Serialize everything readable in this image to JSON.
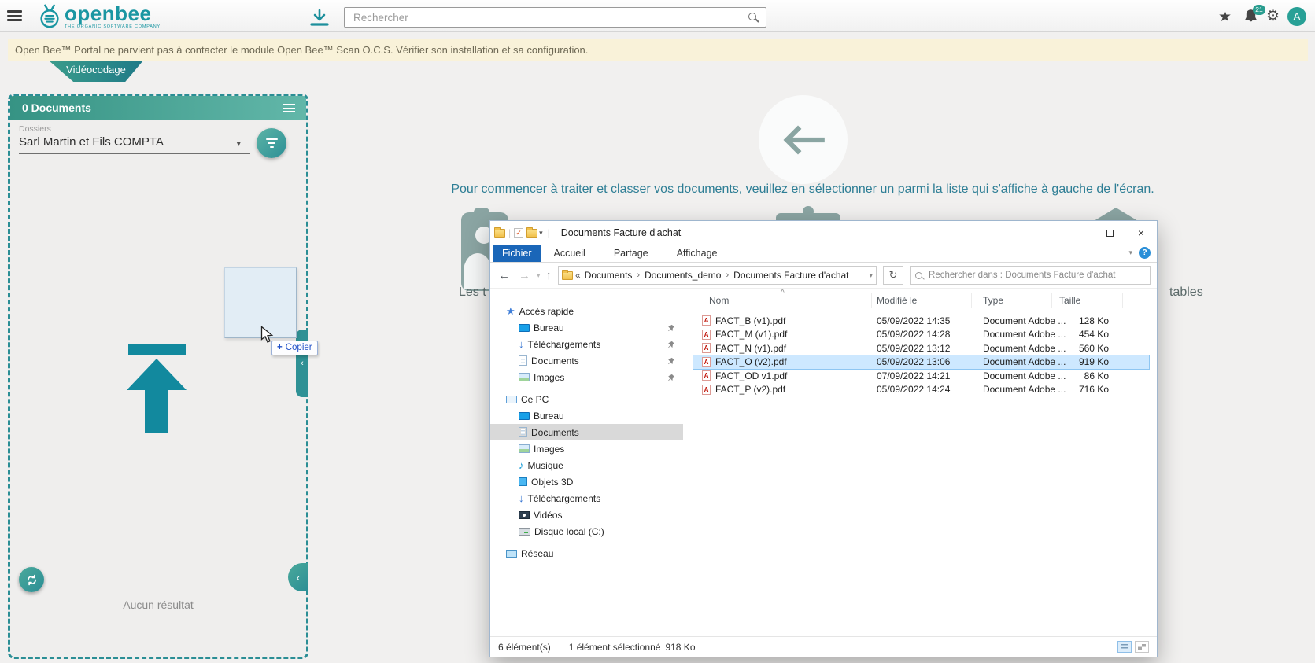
{
  "topbar": {
    "logo_text": "openbee",
    "logo_tagline": "THE ORGANIC SOFTWARE COMPANY",
    "search_placeholder": "Rechercher",
    "notifications_badge": "21",
    "avatar_letter": "A"
  },
  "banner": {
    "message": "Open Bee™ Portal ne parvient pas à contacter le module Open Bee™ Scan O.C.S. Vérifier son installation et sa configuration."
  },
  "workflow_tab": {
    "label": "Vidéocodage"
  },
  "documents_panel": {
    "header_title": "0 Documents",
    "folders_label": "Dossiers",
    "folders_value": "Sarl Martin et Fils COMPTA",
    "empty_message": "Aucun résultat",
    "drag_tooltip_plus": "+",
    "drag_tooltip_label": "Copier"
  },
  "main_area": {
    "instruction": "Pour commencer à traiter et classer vos documents, veuillez en sélectionner un parmi la liste qui s'affiche à gauche de l'écran.",
    "background_text_left": "Les t",
    "background_text_right": "tables"
  },
  "explorer": {
    "window_title": "Documents Facture d'achat",
    "ribbon_tabs": [
      "Fichier",
      "Accueil",
      "Partage",
      "Affichage"
    ],
    "address_prefix": "«",
    "breadcrumbs": [
      "Documents",
      "Documents_demo",
      "Documents Facture d'achat"
    ],
    "search_placeholder": "Rechercher dans : Documents Facture d'achat",
    "nav": {
      "quick_access_label": "Accès rapide",
      "quick_access_items": [
        "Bureau",
        "Téléchargements",
        "Documents",
        "Images"
      ],
      "this_pc_label": "Ce PC",
      "this_pc_items": [
        "Bureau",
        "Documents",
        "Images",
        "Musique",
        "Objets 3D",
        "Téléchargements",
        "Vidéos",
        "Disque local (C:)"
      ],
      "network_label": "Réseau"
    },
    "columns": {
      "name": "Nom",
      "modified": "Modifié le",
      "type": "Type",
      "size": "Taille"
    },
    "files": [
      {
        "name": "FACT_B (v1).pdf",
        "modified": "05/09/2022 14:35",
        "type": "Document Adobe ...",
        "size": "128 Ko"
      },
      {
        "name": "FACT_M (v1).pdf",
        "modified": "05/09/2022 14:28",
        "type": "Document Adobe ...",
        "size": "454 Ko"
      },
      {
        "name": "FACT_N (v1).pdf",
        "modified": "05/09/2022 13:12",
        "type": "Document Adobe ...",
        "size": "560 Ko"
      },
      {
        "name": "FACT_O (v2).pdf",
        "modified": "05/09/2022 13:06",
        "type": "Document Adobe ...",
        "size": "919 Ko"
      },
      {
        "name": "FACT_OD v1.pdf",
        "modified": "07/09/2022 14:21",
        "type": "Document Adobe ...",
        "size": "86 Ko"
      },
      {
        "name": "FACT_P (v2).pdf",
        "modified": "05/09/2022 14:24",
        "type": "Document Adobe ...",
        "size": "716 Ko"
      }
    ],
    "status": {
      "items_count": "6 élément(s)",
      "selection": "1 élément sélectionné",
      "selection_size": "918 Ko"
    }
  },
  "icons": {
    "star": "★",
    "gear": "⚙",
    "back": "←",
    "forward": "→",
    "up": "↑",
    "dropdown": "▾",
    "caret_down": "▾",
    "refresh": "↻",
    "breadcrumb_sep": "›",
    "sort_asc": "^",
    "chevron_left": "‹",
    "help": "?",
    "music_note": "♪",
    "download_arrow": "↓",
    "pipe": "|",
    "minimize": "–",
    "close": "×",
    "pdf_badge": "A"
  },
  "colors": {
    "accent_teal": "#2b8e95",
    "selection_blue": "#cde8ff",
    "warning_bg": "#f9f2d9",
    "tab_active_blue": "#1a66b8"
  }
}
